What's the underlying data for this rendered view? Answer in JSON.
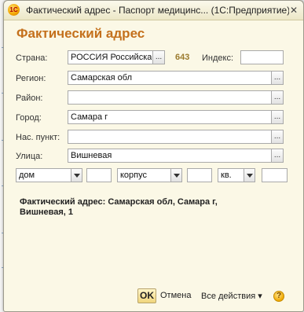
{
  "window": {
    "title": "Фактический адрес - Паспорт медицинс... (1С:Предприятие)",
    "app_icon": "1c-logo-icon",
    "close_glyph": "✕"
  },
  "form": {
    "heading": "Фактический адрес",
    "country": {
      "label": "Страна:",
      "value": "РОССИЯ Российска",
      "code": "643",
      "button": "..."
    },
    "index": {
      "label": "Индекс:",
      "value": ""
    },
    "region": {
      "label": "Регион:",
      "value": "Самарская обл",
      "button": "..."
    },
    "district": {
      "label": "Район:",
      "value": "",
      "button": "..."
    },
    "city": {
      "label": "Город:",
      "value": "Самара г",
      "button": "..."
    },
    "settlement": {
      "label": "Нас. пункт:",
      "value": "",
      "button": "..."
    },
    "street": {
      "label": "Улица:",
      "value": "Вишневая",
      "button": "..."
    },
    "house": {
      "type": "дом",
      "value": ""
    },
    "building": {
      "type": "корпус",
      "value": ""
    },
    "apartment": {
      "type": "кв.",
      "value": ""
    },
    "summary": "Фактический адрес: Самарская обл, Самара г, Вишневая, 1"
  },
  "footer": {
    "ok_label": "OK",
    "cancel_label": "Отмена",
    "actions_label": "Все действия ▾",
    "help_icon": "help-icon",
    "help_glyph": "?"
  },
  "colors": {
    "heading": "#c4701c",
    "background": "#fbf8e6",
    "code": "#9b7b2e"
  }
}
